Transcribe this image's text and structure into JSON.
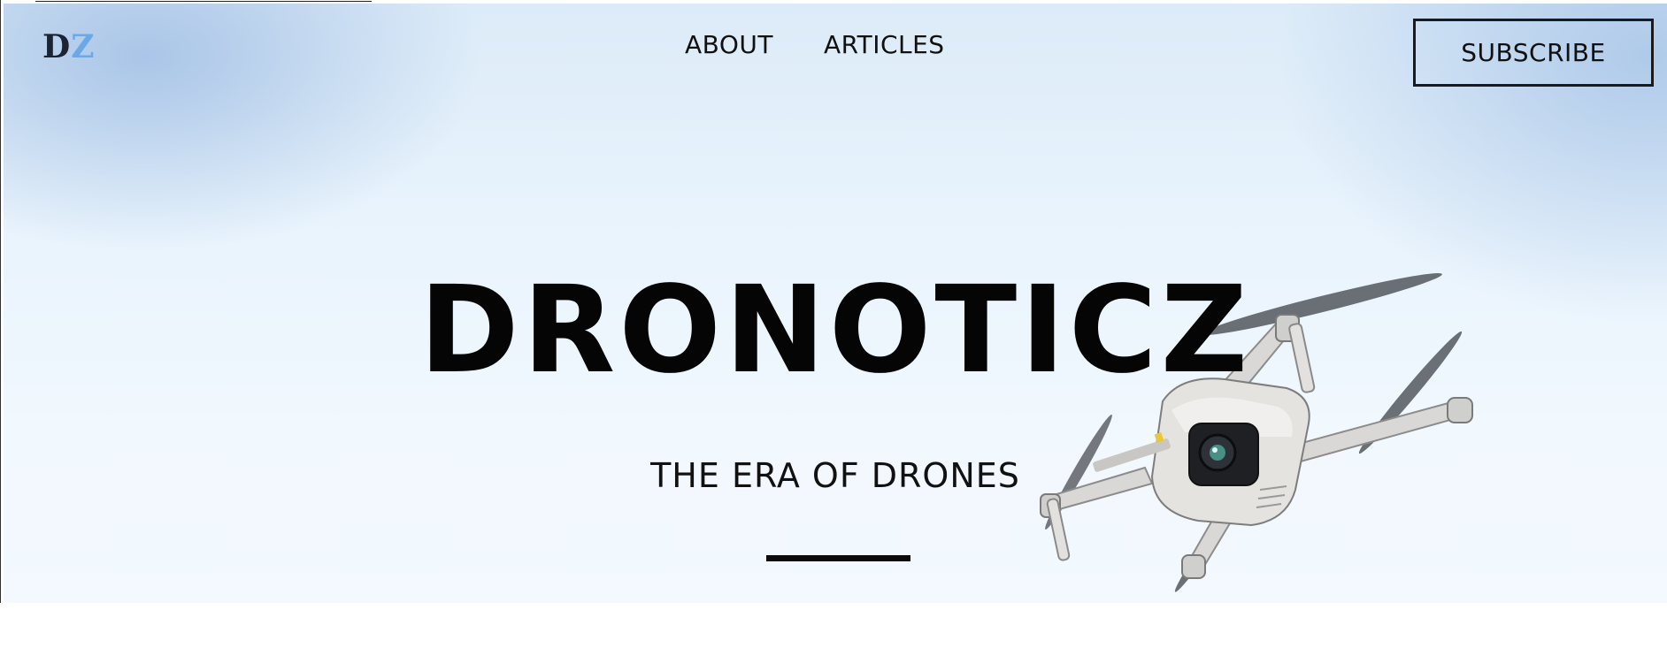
{
  "brand": {
    "logo_letter_1": "D",
    "logo_letter_2": "Z"
  },
  "nav": {
    "items": [
      {
        "label": "ABOUT"
      },
      {
        "label": "ARTICLES"
      }
    ]
  },
  "actions": {
    "subscribe_label": "SUBSCRIBE"
  },
  "hero": {
    "title": "DRONOTICZ",
    "subtitle": "THE ERA OF DRONES",
    "image": "drone-photo"
  },
  "colors": {
    "logo_dark": "#1c2433",
    "logo_accent": "#6aa8e6",
    "sky_light": "#f1f8fe",
    "sky_blue": "#a8c4e8",
    "text": "#050505"
  }
}
